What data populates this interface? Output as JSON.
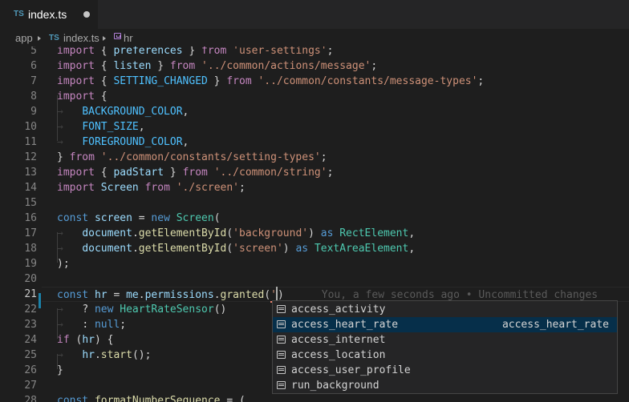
{
  "tab": {
    "badge": "TS",
    "title": "index.ts"
  },
  "breadcrumb": {
    "folder": "app",
    "file_badge": "TS",
    "file": "index.ts",
    "symbol": "hr"
  },
  "lines": [
    {
      "n": "5"
    },
    {
      "n": "6"
    },
    {
      "n": "7"
    },
    {
      "n": "8"
    },
    {
      "n": "9"
    },
    {
      "n": "10"
    },
    {
      "n": "11"
    },
    {
      "n": "12"
    },
    {
      "n": "13"
    },
    {
      "n": "14"
    },
    {
      "n": "15"
    },
    {
      "n": "16"
    },
    {
      "n": "17"
    },
    {
      "n": "18"
    },
    {
      "n": "19"
    },
    {
      "n": "20"
    },
    {
      "n": "21"
    },
    {
      "n": "22"
    },
    {
      "n": "23"
    },
    {
      "n": "24"
    },
    {
      "n": "25"
    },
    {
      "n": "26"
    },
    {
      "n": "27"
    },
    {
      "n": "28"
    }
  ],
  "code": {
    "l5": [
      "import",
      " { ",
      "preferences",
      " } ",
      "from",
      " ",
      "'user-settings'",
      ";"
    ],
    "l6": [
      "import",
      " { ",
      "listen",
      " } ",
      "from",
      " ",
      "'../common/actions/message'",
      ";"
    ],
    "l7": [
      "import",
      " { ",
      "SETTING_CHANGED",
      " } ",
      "from",
      " ",
      "'../common/constants/message-types'",
      ";"
    ],
    "l8": [
      "import",
      " {"
    ],
    "l9": [
      "BACKGROUND_COLOR",
      ","
    ],
    "l10": [
      "FONT_SIZE",
      ","
    ],
    "l11": [
      "FOREGROUND_COLOR",
      ","
    ],
    "l12": [
      "} ",
      "from",
      " ",
      "'../common/constants/setting-types'",
      ";"
    ],
    "l13": [
      "import",
      " { ",
      "padStart",
      " } ",
      "from",
      " ",
      "'../common/string'",
      ";"
    ],
    "l14": [
      "import",
      " ",
      "Screen",
      " ",
      "from",
      " ",
      "'./screen'",
      ";"
    ],
    "l16": [
      "const",
      " ",
      "screen",
      " = ",
      "new",
      " ",
      "Screen",
      "("
    ],
    "l17": [
      "document",
      ".",
      "getElementById",
      "(",
      "'background'",
      ") ",
      "as",
      " ",
      "RectElement",
      ","
    ],
    "l18": [
      "document",
      ".",
      "getElementById",
      "(",
      "'screen'",
      ") ",
      "as",
      " ",
      "TextAreaElement",
      ","
    ],
    "l19": [
      ");"
    ],
    "l21": [
      "const",
      " ",
      "hr",
      " = ",
      "me",
      ".",
      "permissions",
      ".",
      "granted",
      "(",
      "'",
      ")"
    ],
    "l21_blame": "You, a few seconds ago • Uncommitted changes",
    "l22": [
      "? ",
      "new",
      " ",
      "HeartRateSensor",
      "()"
    ],
    "l23": [
      ": ",
      "null",
      ";"
    ],
    "l24": [
      "if",
      " (",
      "hr",
      ") {"
    ],
    "l25": [
      "hr",
      ".",
      "start",
      "();"
    ],
    "l26": [
      "}"
    ],
    "l28": [
      "const",
      " ",
      "formatNumberSequence",
      " = ("
    ]
  },
  "suggest": {
    "items": [
      {
        "label": "access_activity"
      },
      {
        "label": "access_heart_rate",
        "detail": "access_heart_rate"
      },
      {
        "label": "access_internet"
      },
      {
        "label": "access_location"
      },
      {
        "label": "access_user_profile"
      },
      {
        "label": "run_background"
      }
    ],
    "selected_index": 1
  },
  "colors": {
    "keyword": "#569cd6",
    "control": "#c586c0",
    "string": "#ce9178",
    "variable": "#9cdcfe",
    "function": "#dcdcaa",
    "type": "#4ec9b0",
    "constant": "#4fc1ff",
    "selection": "#062f4a",
    "modified_gutter": "#1b81a8"
  }
}
